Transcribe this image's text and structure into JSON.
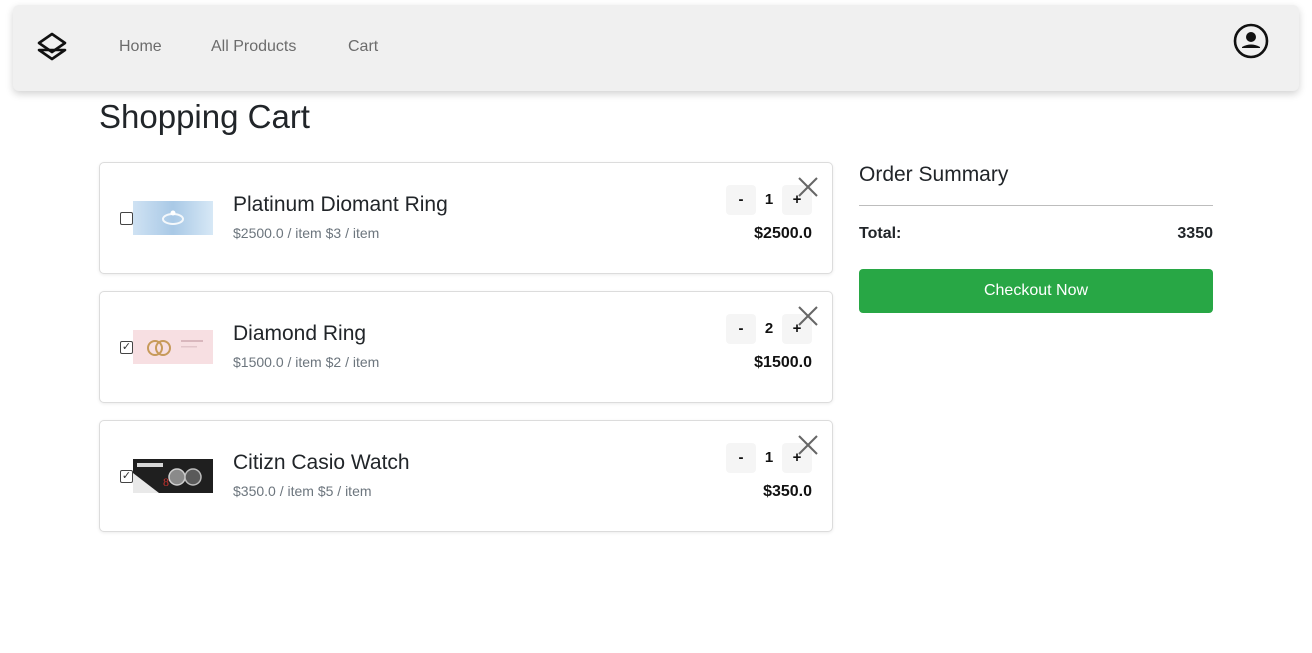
{
  "nav": {
    "logo_icon": "layers-logo-icon",
    "links": [
      "Home",
      "All Products",
      "Cart"
    ],
    "user_icon": "user-circle-icon"
  },
  "page": {
    "title": "Shopping Cart"
  },
  "cart": {
    "items": [
      {
        "name": "Platinum Diomant Ring",
        "price_text": "$2500.0 / item $3 / item",
        "quantity": "1",
        "line_total": "$2500.0",
        "checked": false,
        "decrement": "-",
        "increment": "+",
        "remove_icon": "close-icon"
      },
      {
        "name": "Diamond Ring",
        "price_text": "$1500.0 / item $2 / item",
        "quantity": "2",
        "line_total": "$1500.0",
        "checked": true,
        "decrement": "-",
        "increment": "+",
        "remove_icon": "close-icon"
      },
      {
        "name": "Citizn Casio Watch",
        "price_text": "$350.0 / item $5 / item",
        "quantity": "1",
        "line_total": "$350.0",
        "checked": true,
        "decrement": "-",
        "increment": "+",
        "remove_icon": "close-icon"
      }
    ]
  },
  "summary": {
    "title": "Order Summary",
    "total_label": "Total:",
    "total_value": "3350",
    "checkout_label": "Checkout Now"
  },
  "colors": {
    "navbar_bg": "#f0f0f0",
    "checkout_green": "#28a745"
  }
}
